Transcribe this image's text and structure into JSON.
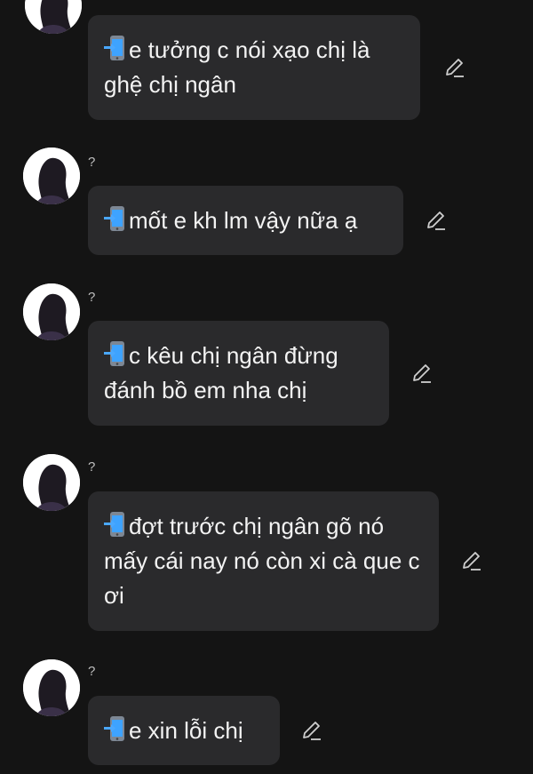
{
  "messages": [
    {
      "sender_mark": "",
      "text": "e tưởng c nói xạo chị là ghệ chị ngân"
    },
    {
      "sender_mark": "?",
      "text": "mốt e kh lm vậy nữa ạ"
    },
    {
      "sender_mark": "?",
      "text": "c kêu chị ngân đừng đánh bồ em nha chị"
    },
    {
      "sender_mark": "?",
      "text": "đợt trước chị ngân gõ nó mấy cái nay nó còn xi cà que c ơi"
    },
    {
      "sender_mark": "?",
      "text": "e xin lỗi chị"
    }
  ],
  "icons": {
    "message_prefix": "mobile-phone-with-arrow-icon",
    "edit": "pencil-edit-icon",
    "avatar": "silhouette-avatar-icon"
  },
  "colors": {
    "background": "#141414",
    "bubble": "#2a2a2c",
    "text": "#f3f3f3"
  }
}
